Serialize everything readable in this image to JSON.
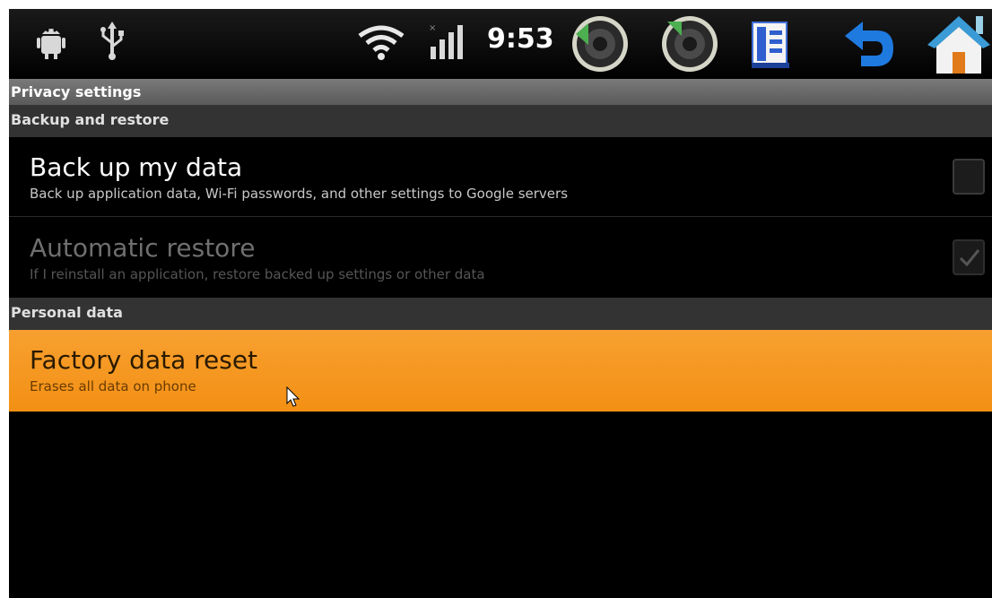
{
  "status_bar": {
    "time": "9:53",
    "icons": [
      "android-debug-icon",
      "usb-icon",
      "wifi-icon",
      "signal-icon",
      "volume-down-icon",
      "volume-up-icon",
      "menu-icon",
      "back-icon",
      "home-icon"
    ]
  },
  "title": "Privacy settings",
  "sections": [
    {
      "header": "Backup and restore",
      "items": [
        {
          "title": "Back up my data",
          "summary": "Back up application data, Wi-Fi passwords, and other settings to Google servers",
          "checked": false,
          "enabled": true
        },
        {
          "title": "Automatic restore",
          "summary": "If I reinstall an application, restore backed up settings or other data",
          "checked": true,
          "enabled": false
        }
      ]
    },
    {
      "header": "Personal data",
      "items": [
        {
          "title": "Factory data reset",
          "summary": "Erases all data on phone",
          "highlighted": true
        }
      ]
    }
  ],
  "colors": {
    "highlight": "#f39014",
    "background": "#000000",
    "category_bg": "#333333",
    "title_bar_bg": "#6a6a6a"
  }
}
